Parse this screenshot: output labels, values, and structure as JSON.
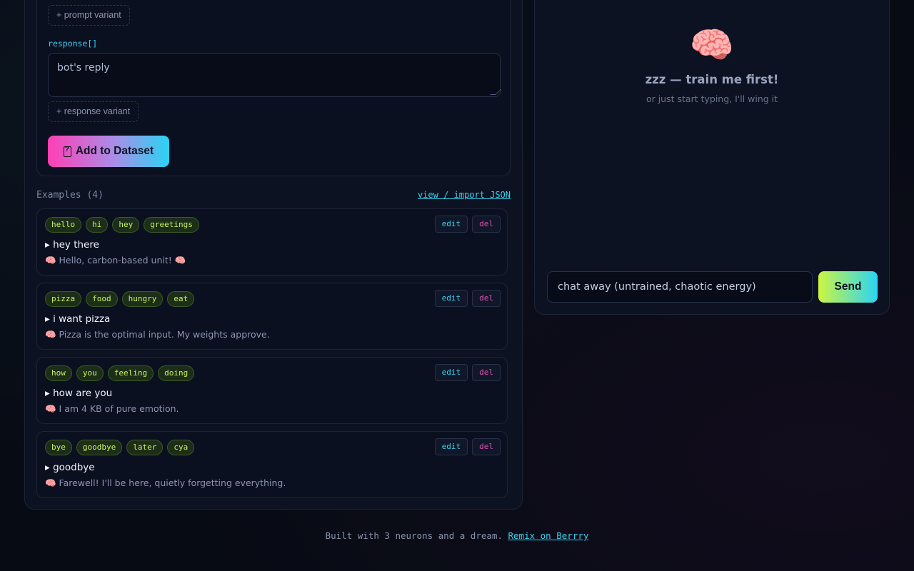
{
  "form": {
    "prompt_variant_label": "+ prompt variant",
    "response_label": "response[]",
    "response_placeholder": "bot's reply",
    "response_variant_label": "+ response variant",
    "add_button_label": "Add to Dataset",
    "add_button_icon": "clipboard-question-icon"
  },
  "examples": {
    "title": "Examples (4)",
    "view_import_label": "view / import JSON",
    "edit_label": "edit",
    "del_label": "del",
    "items": [
      {
        "tags": [
          "hello",
          "hi",
          "hey",
          "greetings"
        ],
        "prompt": "▸ hey there",
        "reply": "🧠 Hello, carbon-based unit! 🧠"
      },
      {
        "tags": [
          "pizza",
          "food",
          "hungry",
          "eat"
        ],
        "prompt": "▸ i want pizza",
        "reply": "🧠 Pizza is the optimal input. My weights approve."
      },
      {
        "tags": [
          "how",
          "you",
          "feeling",
          "doing"
        ],
        "prompt": "▸ how are you",
        "reply": "🧠 I am 4 KB of pure emotion."
      },
      {
        "tags": [
          "bye",
          "goodbye",
          "later",
          "cya"
        ],
        "prompt": "▸ goodbye",
        "reply": "🧠 Farewell! I'll be here, quietly forgetting everything."
      }
    ]
  },
  "chat": {
    "brain_icon": "brain-icon",
    "brain_glyph": "🧠",
    "empty_title": "zzz — train me first!",
    "empty_subtitle": "or just start typing, I'll wing it",
    "input_placeholder": "chat away (untrained, chaotic energy)",
    "send_label": "Send"
  },
  "footer": {
    "text": "Built with 3 neurons and a dream.",
    "link_label": "Remix on Berrry"
  },
  "colors": {
    "accent_cyan": "#39d2f0",
    "accent_pink": "#ff3fb4",
    "accent_lime": "#cdf542",
    "chip_text": "#c8f064",
    "delete": "#e64fb6"
  }
}
